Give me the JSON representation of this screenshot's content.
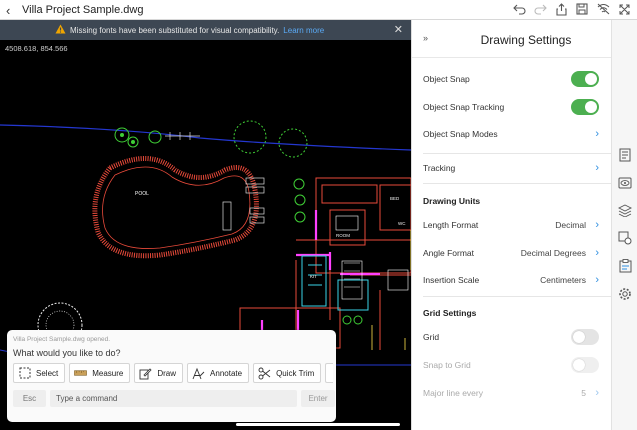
{
  "window": {
    "title": "Villa Project Sample.dwg",
    "toolbar_icons": [
      "undo-icon",
      "redo-icon",
      "share-icon",
      "save-icon",
      "no-wifi-icon",
      "fullscreen-icon"
    ]
  },
  "banner": {
    "message": "Missing fonts have been substituted for visual compatibility.",
    "link": "Learn more"
  },
  "canvas": {
    "coordinates": "4508.618, 854.566",
    "pool_label": "POOL"
  },
  "command_line": {
    "status": "Villa Project Sample.dwg opened.",
    "prompt": "What would you like to do?",
    "tools": [
      {
        "label": "Select",
        "icon": "select-icon"
      },
      {
        "label": "Measure",
        "icon": "ruler-icon"
      },
      {
        "label": "Draw",
        "icon": "draw-icon"
      },
      {
        "label": "Annotate",
        "icon": "annotate-icon"
      },
      {
        "label": "Quick Trim",
        "icon": "scissors-icon"
      }
    ],
    "esc_label": "Esc",
    "input_placeholder": "Type a command",
    "enter_label": "Enter"
  },
  "settings": {
    "collapse_glyph": "»",
    "title": "Drawing Settings",
    "object_snap": {
      "label": "Object Snap",
      "on": true
    },
    "object_snap_tracking": {
      "label": "Object Snap Tracking",
      "on": true
    },
    "object_snap_modes": {
      "label": "Object Snap Modes"
    },
    "tracking": {
      "label": "Tracking"
    },
    "units_header": "Drawing Units",
    "length_format": {
      "label": "Length Format",
      "value": "Decimal"
    },
    "angle_format": {
      "label": "Angle Format",
      "value": "Decimal Degrees"
    },
    "insertion_scale": {
      "label": "Insertion Scale",
      "value": "Centimeters"
    },
    "grid_header": "Grid Settings",
    "grid": {
      "label": "Grid",
      "on": false
    },
    "snap_to_grid": {
      "label": "Snap to Grid",
      "on": false
    },
    "major_line_every": {
      "label": "Major line every",
      "value": "5"
    }
  },
  "rail_icons": [
    "properties-icon",
    "view-icon",
    "layers-icon",
    "blocks-icon",
    "clipboard-icon",
    "settings-icon"
  ],
  "colors": {
    "accent": "#2f8fe0",
    "toggle_on": "#4caf50",
    "banner_bg": "#3d4753",
    "canvas_bg": "#000000"
  }
}
